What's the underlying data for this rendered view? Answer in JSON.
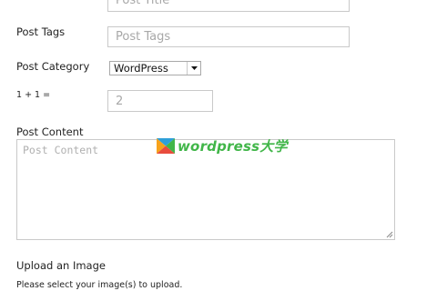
{
  "form": {
    "post_title": {
      "placeholder": "Post Title"
    },
    "post_tags": {
      "label": "Post Tags",
      "placeholder": "Post Tags"
    },
    "post_category": {
      "label": "Post Category",
      "selected": "WordPress"
    },
    "captcha": {
      "label": "1 + 1 =",
      "value": "2"
    },
    "post_content": {
      "label": "Post Content",
      "placeholder": "Post Content"
    },
    "upload": {
      "heading": "Upload an Image",
      "instruction": "Please select your image(s) to upload."
    }
  },
  "watermark": {
    "text": "wordpress",
    "cjk": "大学"
  },
  "colors": {
    "accent": "#41b649",
    "border": "#c9c9c9",
    "placeholder": "#a8a8a8"
  }
}
